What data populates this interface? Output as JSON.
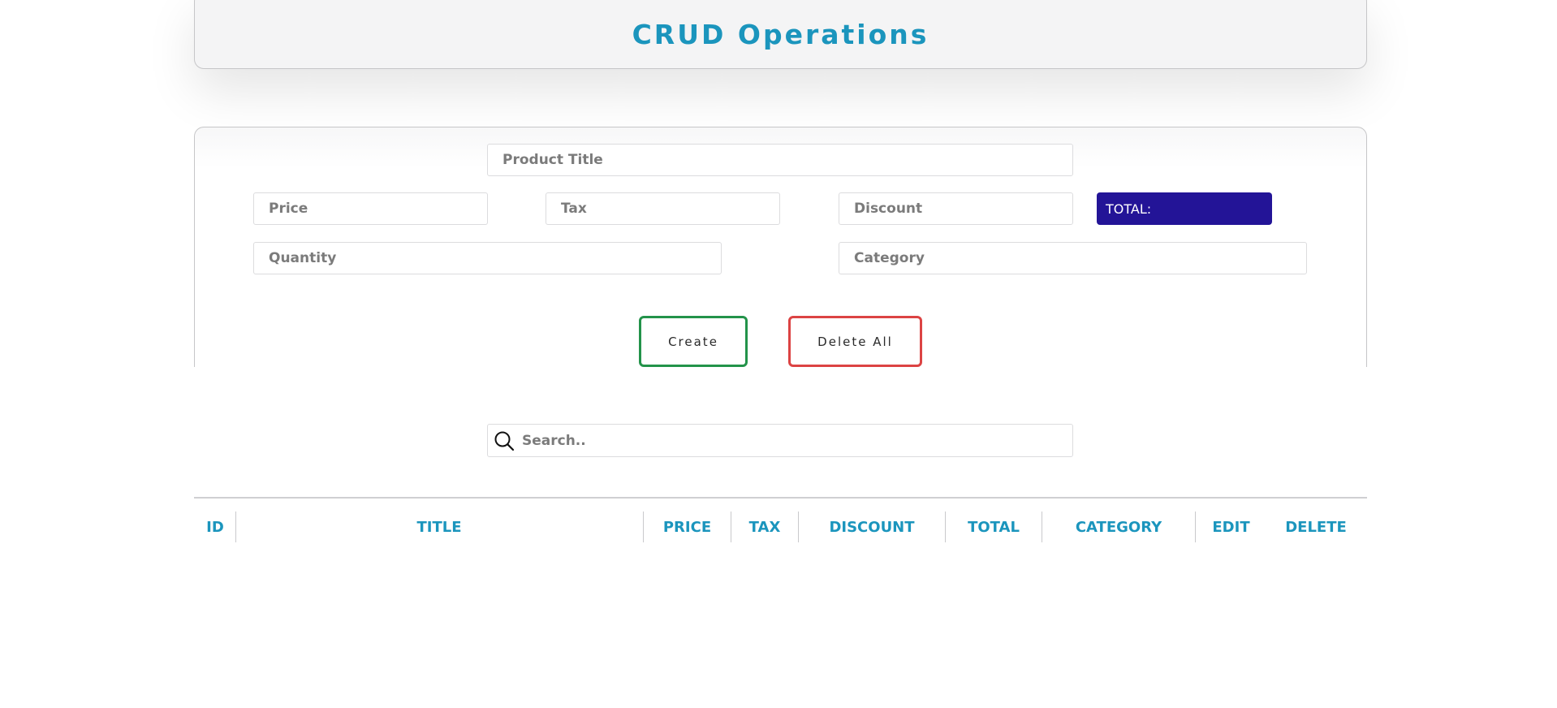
{
  "header": {
    "title": "CRUD Operations"
  },
  "form": {
    "title_placeholder": "Product Title",
    "price_placeholder": "Price",
    "tax_placeholder": "Tax",
    "discount_placeholder": "Discount",
    "total_label": "TOTAL:",
    "quantity_placeholder": "Quantity",
    "category_placeholder": "Category",
    "create_label": "Create",
    "delete_all_label": "Delete All"
  },
  "search": {
    "placeholder": "Search.."
  },
  "table": {
    "columns": [
      "ID",
      "TITLE",
      "PRICE",
      "TAX",
      "DISCOUNT",
      "TOTAL",
      "CATEGORY",
      "EDIT",
      "DELETE"
    ],
    "rows": []
  },
  "colors": {
    "accent": "#1b95bd",
    "total_bg": "#231497",
    "create_border": "#23934a",
    "delete_border": "#dc4343"
  },
  "icons": {
    "search": "search-icon"
  }
}
